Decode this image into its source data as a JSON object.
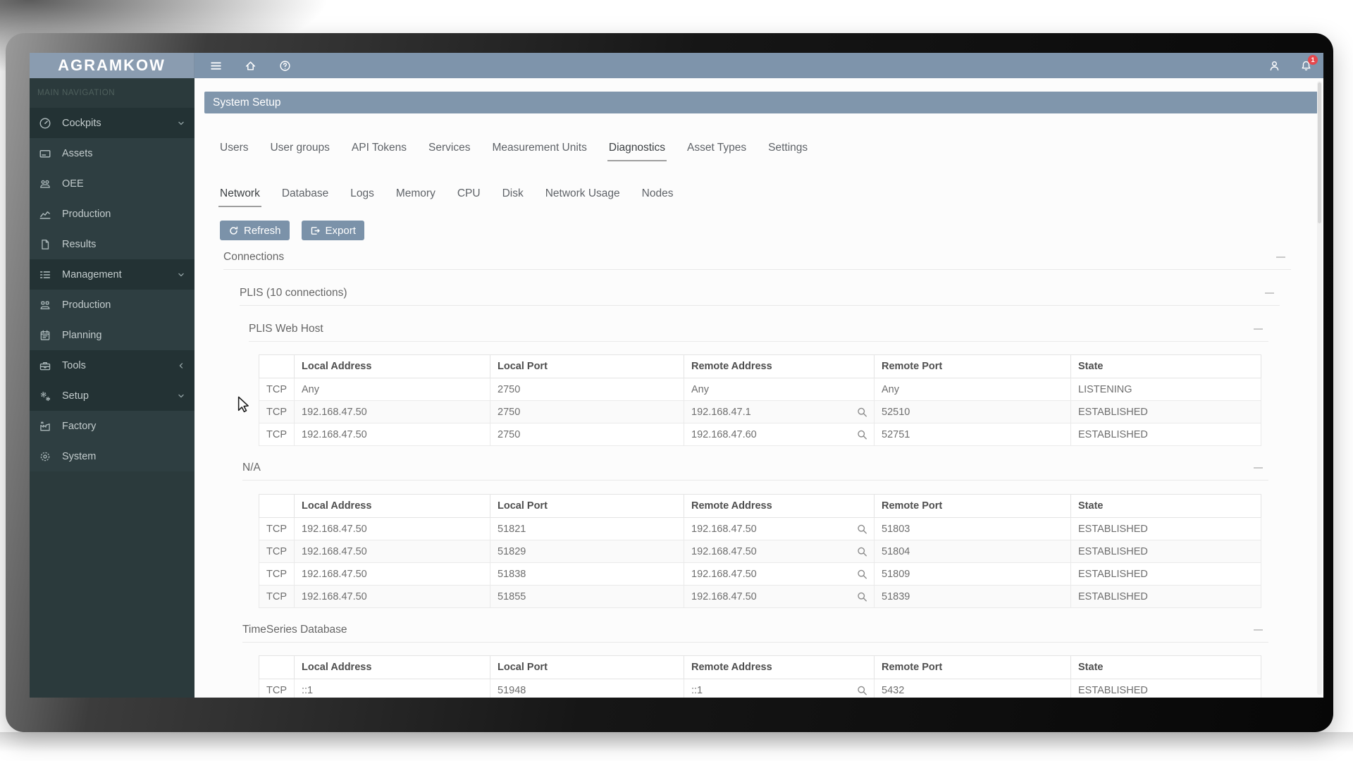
{
  "window": {
    "logo": "AGRAMKOW"
  },
  "topbar": {
    "notification_count": "1"
  },
  "sidebar": {
    "section_label": "MAIN NAVIGATION",
    "items": [
      {
        "label": "Cockpits",
        "icon": "gauge-icon",
        "group": true,
        "chevron": "chevron-down-icon"
      },
      {
        "label": "Assets",
        "icon": "asset-card-icon"
      },
      {
        "label": "OEE",
        "icon": "machines-icon"
      },
      {
        "label": "Production",
        "icon": "line-chart-icon"
      },
      {
        "label": "Results",
        "icon": "document-icon"
      },
      {
        "label": "Management",
        "icon": "checklist-icon",
        "group": true,
        "chevron": "chevron-down-icon"
      },
      {
        "label": "Production",
        "icon": "team-icon"
      },
      {
        "label": "Planning",
        "icon": "calendar-icon"
      },
      {
        "label": "Tools",
        "icon": "toolbox-icon",
        "group": true,
        "chevron": "chevron-left-icon"
      },
      {
        "label": "Setup",
        "icon": "gears-icon",
        "group": true,
        "chevron": "chevron-down-icon"
      },
      {
        "label": "Factory",
        "icon": "factory-icon"
      },
      {
        "label": "System",
        "icon": "gear-icon"
      }
    ]
  },
  "page": {
    "title": "System Setup"
  },
  "main_tabs": [
    {
      "label": "Users"
    },
    {
      "label": "User groups"
    },
    {
      "label": "API Tokens"
    },
    {
      "label": "Services"
    },
    {
      "label": "Measurement Units"
    },
    {
      "label": "Diagnostics",
      "active": true
    },
    {
      "label": "Asset Types"
    },
    {
      "label": "Settings"
    }
  ],
  "sub_tabs": [
    {
      "label": "Network",
      "active": true
    },
    {
      "label": "Database"
    },
    {
      "label": "Logs"
    },
    {
      "label": "Memory"
    },
    {
      "label": "CPU"
    },
    {
      "label": "Disk"
    },
    {
      "label": "Network Usage"
    },
    {
      "label": "Nodes"
    }
  ],
  "toolbar": {
    "refresh": "Refresh",
    "export": "Export"
  },
  "connections": {
    "title": "Connections",
    "group_title": "PLIS (10 connections)",
    "table_headers": [
      "",
      "Local Address",
      "Local Port",
      "Remote Address",
      "Remote Port",
      "State"
    ],
    "tables": [
      {
        "title": "PLIS Web Host",
        "rows": [
          {
            "proto": "TCP",
            "local_address": "Any",
            "local_port": "2750",
            "remote_address": "Any",
            "remote_search": false,
            "remote_port": "Any",
            "state": "LISTENING"
          },
          {
            "proto": "TCP",
            "local_address": "192.168.47.50",
            "local_port": "2750",
            "remote_address": "192.168.47.1",
            "remote_search": true,
            "remote_port": "52510",
            "state": "ESTABLISHED"
          },
          {
            "proto": "TCP",
            "local_address": "192.168.47.50",
            "local_port": "2750",
            "remote_address": "192.168.47.60",
            "remote_search": true,
            "remote_port": "52751",
            "state": "ESTABLISHED"
          }
        ]
      },
      {
        "title": "N/A",
        "rows": [
          {
            "proto": "TCP",
            "local_address": "192.168.47.50",
            "local_port": "51821",
            "remote_address": "192.168.47.50",
            "remote_search": true,
            "remote_port": "51803",
            "state": "ESTABLISHED"
          },
          {
            "proto": "TCP",
            "local_address": "192.168.47.50",
            "local_port": "51829",
            "remote_address": "192.168.47.50",
            "remote_search": true,
            "remote_port": "51804",
            "state": "ESTABLISHED"
          },
          {
            "proto": "TCP",
            "local_address": "192.168.47.50",
            "local_port": "51838",
            "remote_address": "192.168.47.50",
            "remote_search": true,
            "remote_port": "51809",
            "state": "ESTABLISHED"
          },
          {
            "proto": "TCP",
            "local_address": "192.168.47.50",
            "local_port": "51855",
            "remote_address": "192.168.47.50",
            "remote_search": true,
            "remote_port": "51839",
            "state": "ESTABLISHED"
          }
        ]
      },
      {
        "title": "TimeSeries Database",
        "rows": [
          {
            "proto": "TCP",
            "local_address": "::1",
            "local_port": "51948",
            "remote_address": "::1",
            "remote_search": true,
            "remote_port": "5432",
            "state": "ESTABLISHED"
          }
        ]
      }
    ]
  },
  "colors": {
    "header_bar": "#7e94ab",
    "logo_bg": "#8a9cb0",
    "title_bar": "#8096ac",
    "button": "#7b92a9",
    "badge": "#e5484d",
    "sidebar_bg": "#2b3a3c"
  }
}
